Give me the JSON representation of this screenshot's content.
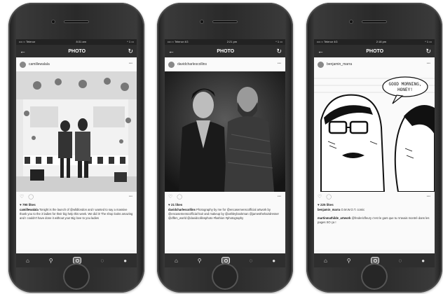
{
  "screens": [
    {
      "status": {
        "carrier": "•••○○ Telenor",
        "time": "8:31 am",
        "battery": "* 1 ▭"
      },
      "nav": {
        "title": "PHOTO",
        "back_icon": "arrow-left-icon",
        "refresh_icon": "refresh-icon"
      },
      "post": {
        "username": "camillewalala",
        "likes": "790 likes",
        "caption_user": "camillewalala",
        "caption": "Tonight is the launch of @wlldlondon and I wanted to say a massive thank you to the 3 ladies for their big help this week. We did it! The shop looks amazing and I couldn't have done it without you! Big love to you ladies"
      }
    },
    {
      "status": {
        "carrier": "•••○○ Telenor 4G",
        "time": "2:21 pm",
        "battery": "* 1 ▭"
      },
      "nav": {
        "title": "PHOTO",
        "back_icon": "arrow-left-icon",
        "refresh_icon": "refresh-icon"
      },
      "post": {
        "username": "davidcharlescollins",
        "likes": "21 likes",
        "caption_user": "davidcharlescollins",
        "caption": "Photography by me for @encasemenscofficial artwork by @encasemenscofficial hair and makeup by @ashleybookman @jamesthehairdresser @dfbm_world @davidcollinsphoto #fashion #photography"
      }
    },
    {
      "status": {
        "carrier": "•••○○ Telenor 4G",
        "time": "2:18 pm",
        "battery": "* 1 ▭"
      },
      "nav": {
        "title": "PHOTO",
        "back_icon": "arrow-left-icon",
        "refresh_icon": "refresh-icon"
      },
      "post": {
        "username": "benjamin_marra",
        "likes": "225 likes",
        "caption_user": "benjamin_marra",
        "caption": "O.M.W.O.T. comic",
        "comment_user": "martinmathilde_artwork",
        "comment": "@fredericfleury c'est le gars que tu m'avais montré dans les pages SO ça !",
        "bubble_text": "GOOD MORNING, HONEY!"
      }
    }
  ],
  "tabbar": [
    "home-icon",
    "search-icon",
    "camera-icon",
    "activity-icon",
    "profile-icon"
  ]
}
